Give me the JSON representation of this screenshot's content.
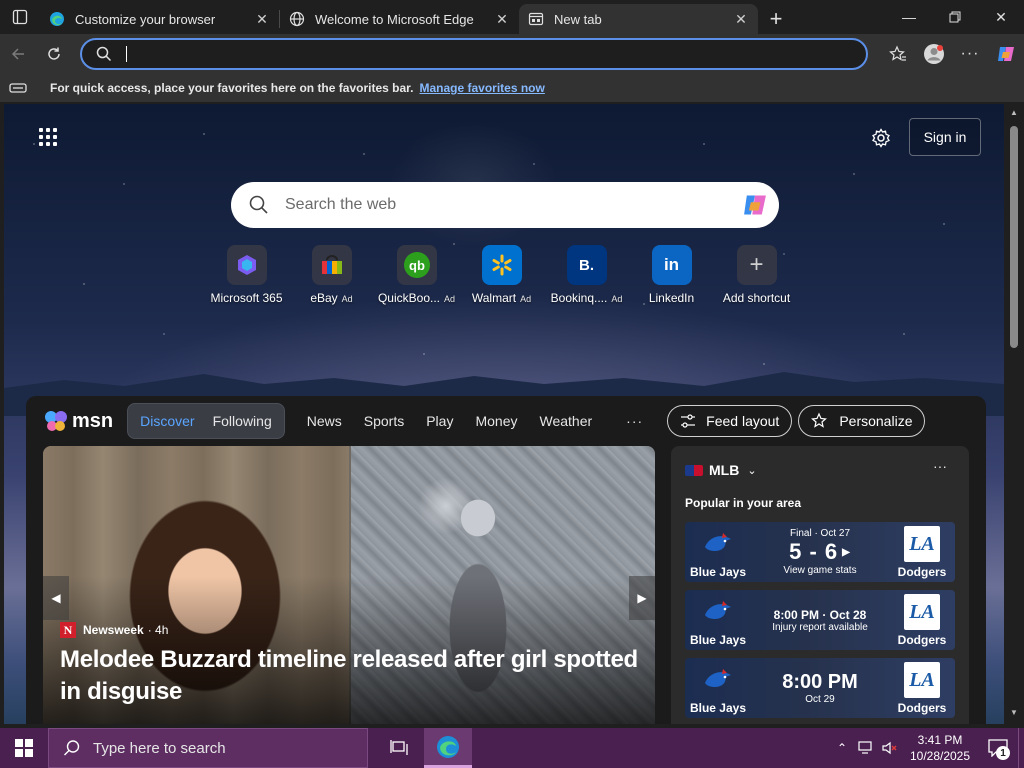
{
  "tabs": [
    {
      "title": "Customize your browser",
      "icon": "edge-icon",
      "active": false
    },
    {
      "title": "Welcome to Microsoft Edge",
      "icon": "globe-icon",
      "active": false
    },
    {
      "title": "New tab",
      "icon": "newtab-icon",
      "active": true
    }
  ],
  "addressbar": {
    "value": "",
    "placeholder": ""
  },
  "favorites_bar": {
    "message": "For quick access, place your favorites here on the favorites bar.",
    "link": "Manage favorites now"
  },
  "newtab": {
    "signin_label": "Sign in",
    "search_placeholder": "Search the web",
    "shortcuts": [
      {
        "label": "Microsoft 365",
        "ad": "",
        "icon": "m365-icon"
      },
      {
        "label": "eBay",
        "ad": "Ad",
        "icon": "ebay-icon"
      },
      {
        "label": "QuickBoo...",
        "ad": "Ad",
        "icon": "quickbooks-icon"
      },
      {
        "label": "Walmart",
        "ad": "Ad",
        "icon": "walmart-icon"
      },
      {
        "label": "Bookinq....",
        "ad": "Ad",
        "icon": "booking-icon"
      },
      {
        "label": "LinkedIn",
        "ad": "",
        "icon": "linkedin-icon"
      },
      {
        "label": "Add shortcut",
        "ad": "",
        "icon": "plus-icon"
      }
    ]
  },
  "feed": {
    "brand": "msn",
    "segments": [
      "Discover",
      "Following"
    ],
    "nav": [
      "News",
      "Sports",
      "Play",
      "Money",
      "Weather"
    ],
    "more": "···",
    "feed_layout": "Feed layout",
    "personalize": "Personalize",
    "hero": {
      "source": "Newsweek",
      "age": "· 4h",
      "headline": "Melodee Buzzard timeline released after girl spotted in disguise"
    },
    "mlb": {
      "title": "MLB",
      "subtitle": "Popular in your area",
      "games": [
        {
          "home": "Blue Jays",
          "away": "Dodgers",
          "line1": "Final · Oct 27",
          "score": "5 - 6",
          "line3": "View game stats",
          "type": "final"
        },
        {
          "home": "Blue Jays",
          "away": "Dodgers",
          "line1": "8:00 PM · Oct 28",
          "score": "",
          "line3": "Injury report available",
          "type": "upcoming"
        },
        {
          "home": "Blue Jays",
          "away": "Dodgers",
          "line1": "8:00 PM",
          "score": "",
          "line3": "Oct 29",
          "type": "big"
        }
      ]
    }
  },
  "taskbar": {
    "search_placeholder": "Type here to search",
    "time": "3:41 PM",
    "date": "10/28/2025",
    "notifications": "1"
  },
  "colors": {
    "accent": "#5b8fe8",
    "link": "#86b9ff",
    "taskbar": "#4a2050"
  }
}
